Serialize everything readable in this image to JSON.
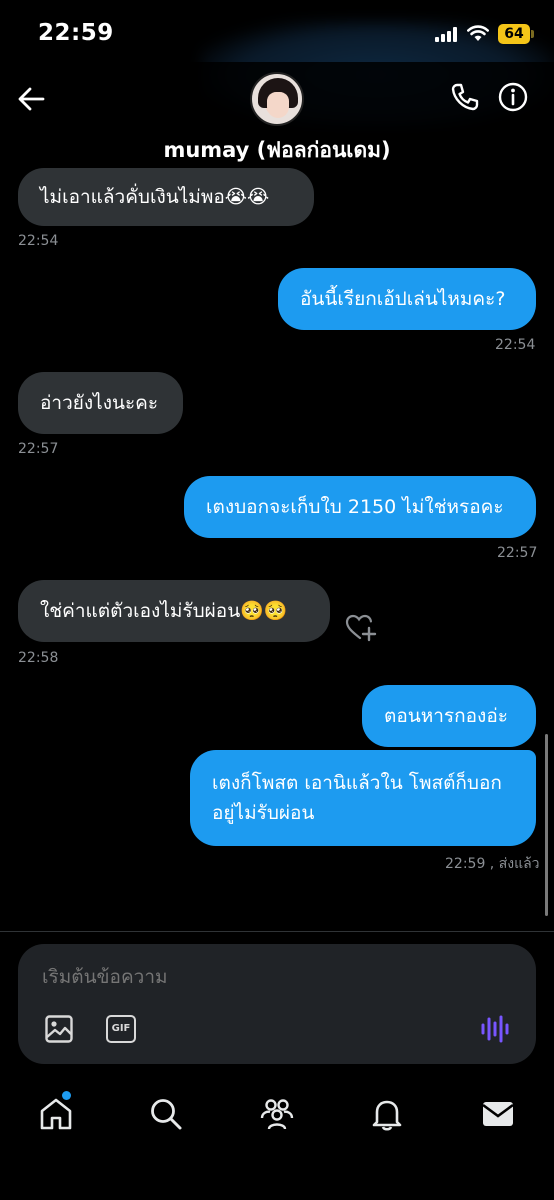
{
  "status_bar": {
    "time": "22:59",
    "battery": "64"
  },
  "header": {
    "contact_name": "mumay (ฟอลก่อนเดม)"
  },
  "messages": [
    {
      "direction": "received",
      "text": "ไม่เอาแล้วคั่บเงินไม่พอ😭😭",
      "time": "22:54"
    },
    {
      "direction": "sent",
      "text": "อันนี้เรียกเอ้ปเล่นไหมคะ?",
      "time": "22:54"
    },
    {
      "direction": "received",
      "text": "อ่าวยังไงนะคะ",
      "time": "22:57"
    },
    {
      "direction": "sent",
      "text": "เตงบอกจะเก็บใบ 2150 ไม่ใช่หรอคะ",
      "time": "22:57"
    },
    {
      "direction": "received",
      "text": "ใช่ค่าแต่ตัวเองไม่รับผ่อน🥺🥺",
      "time": "22:58"
    },
    {
      "direction": "sent",
      "text": "ตอนหารกองอ่ะ",
      "time": ""
    },
    {
      "direction": "sent",
      "text_line1": "เตงก็โพสต เอานิแล้วใน โพสต์ก็บอก",
      "text_line2": "อยู่ไม่รับผ่อน",
      "time": "22:59 , ส่งแล้ว"
    }
  ],
  "composer": {
    "placeholder": "เริ่มต้นข้อความ",
    "gif_label": "GIF"
  },
  "icons": {
    "back": "back-arrow-icon",
    "phone": "phone-icon",
    "info": "info-icon",
    "react": "heart-plus-icon",
    "image": "image-icon",
    "gif": "gif-icon",
    "voice": "voice-wave-icon",
    "home": "home-icon",
    "search": "search-icon",
    "communities": "communities-icon",
    "notifications": "bell-icon",
    "messages": "envelope-icon"
  },
  "colors": {
    "accent": "#1d9bf0",
    "received_bubble": "#2f3336",
    "voice": "#7856ff",
    "battery": "#f5c518"
  }
}
